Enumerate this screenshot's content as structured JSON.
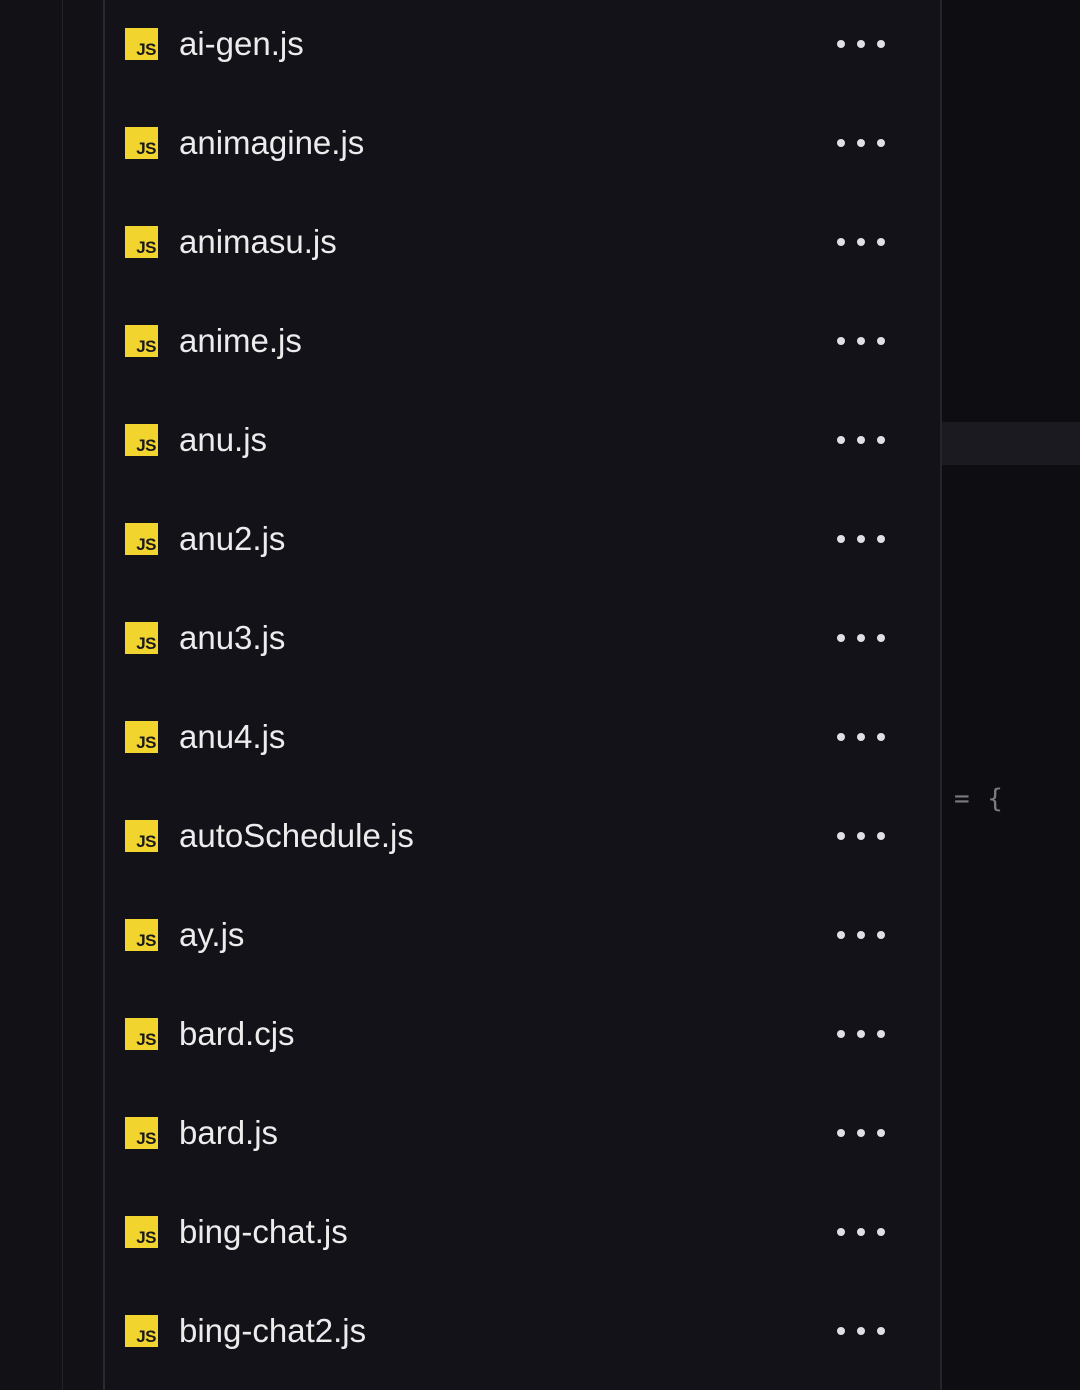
{
  "explorer": {
    "file_icon_text": "JS",
    "files": [
      {
        "name": "ai-gen.js"
      },
      {
        "name": "animagine.js"
      },
      {
        "name": "animasu.js"
      },
      {
        "name": "anime.js"
      },
      {
        "name": "anu.js"
      },
      {
        "name": "anu2.js"
      },
      {
        "name": "anu3.js"
      },
      {
        "name": "anu4.js"
      },
      {
        "name": "autoSchedule.js"
      },
      {
        "name": "ay.js"
      },
      {
        "name": "bard.cjs"
      },
      {
        "name": "bard.js"
      },
      {
        "name": "bing-chat.js"
      },
      {
        "name": "bing-chat2.js"
      }
    ],
    "more_icon": "more-horizontal-icon"
  },
  "editor": {
    "visible_code": "= {"
  },
  "colors": {
    "background": "#121116",
    "js_badge": "#f2d42f",
    "file_text": "#ececec",
    "editor_background": "#0e0d11"
  }
}
